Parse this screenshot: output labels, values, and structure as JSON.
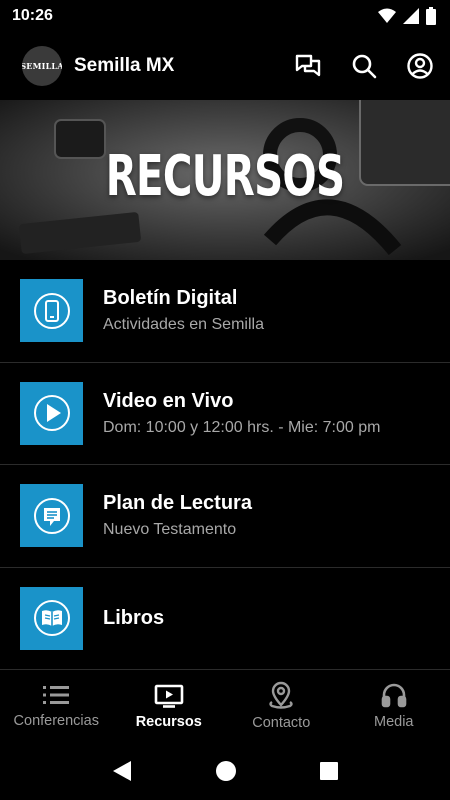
{
  "status_bar": {
    "time": "10:26"
  },
  "app_bar": {
    "title": "Semilla MX",
    "logo_text": "SEMILLA"
  },
  "hero": {
    "title": "RECURSOS"
  },
  "items": [
    {
      "title": "Boletín Digital",
      "subtitle": "Actividades en Semilla",
      "icon": "tablet-icon"
    },
    {
      "title": "Video en Vivo",
      "subtitle": "Dom: 10:00 y 12:00 hrs. - Mie: 7:00 pm",
      "icon": "play-circle-icon"
    },
    {
      "title": "Plan de Lectura",
      "subtitle": "Nuevo Testamento",
      "icon": "note-icon"
    },
    {
      "title": "Libros",
      "subtitle": "",
      "icon": "book-icon"
    }
  ],
  "bottom_nav": [
    {
      "label": "Conferencias",
      "icon": "list-icon",
      "active": false
    },
    {
      "label": "Recursos",
      "icon": "tv-play-icon",
      "active": true
    },
    {
      "label": "Contacto",
      "icon": "location-icon",
      "active": false
    },
    {
      "label": "Media",
      "icon": "headphones-icon",
      "active": false
    }
  ],
  "colors": {
    "accent": "#1a93c9",
    "background": "#000000",
    "divider": "#2b2b2b",
    "muted_text": "#a8a8a8"
  }
}
